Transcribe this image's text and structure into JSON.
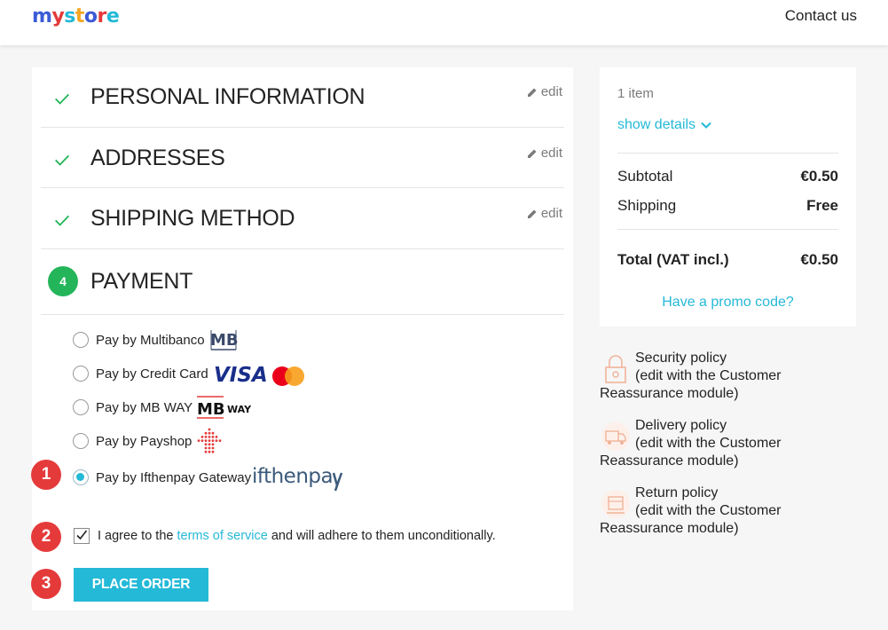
{
  "header": {
    "logo_text": "my store",
    "contact_label": "Contact us"
  },
  "steps": [
    {
      "title": "PERSONAL INFORMATION",
      "edit_label": "edit"
    },
    {
      "title": "ADDRESSES",
      "edit_label": "edit"
    },
    {
      "title": "SHIPPING METHOD",
      "edit_label": "edit"
    }
  ],
  "payment": {
    "step_number": "4",
    "title": "PAYMENT",
    "options": [
      {
        "label": "Pay by Multibanco",
        "logo": "MB",
        "selected": false
      },
      {
        "label": "Pay by Credit Card",
        "logo": "VISA",
        "selected": false
      },
      {
        "label": "Pay by MB WAY",
        "logo": "MB WAY",
        "selected": false
      },
      {
        "label": "Pay by Payshop",
        "logo": "payshop-icon",
        "selected": false
      },
      {
        "label": "Pay by Ifthenpay Gateway",
        "logo": "ifthenpay",
        "selected": true
      }
    ],
    "terms_prefix": "I agree to the",
    "terms_link": "terms of service",
    "terms_suffix": "and will adhere to them unconditionally.",
    "terms_checked": true,
    "place_order_label": "PLACE ORDER"
  },
  "markers": [
    "1",
    "2",
    "3"
  ],
  "summary": {
    "items_count": "1 item",
    "show_details": "show details",
    "subtotal_label": "Subtotal",
    "subtotal_value": "€0.50",
    "shipping_label": "Shipping",
    "shipping_value": "Free",
    "total_label": "Total (VAT incl.)",
    "total_value": "€0.50",
    "promo_label": "Have a promo code?"
  },
  "reassurance": [
    {
      "title": "Security policy",
      "line2": "(edit with the Customer",
      "line3": "Reassurance module)",
      "icon": "lock-icon"
    },
    {
      "title": "Delivery policy",
      "line2": "(edit with the Customer",
      "line3": "Reassurance module)",
      "icon": "delivery-truck-icon"
    },
    {
      "title": "Return policy",
      "line2": "(edit with the Customer",
      "line3": "Reassurance module)",
      "icon": "return-box-icon"
    }
  ],
  "colors": {
    "accent": "#24b9d7",
    "success": "#24b55a",
    "marker": "#e53a3a"
  }
}
